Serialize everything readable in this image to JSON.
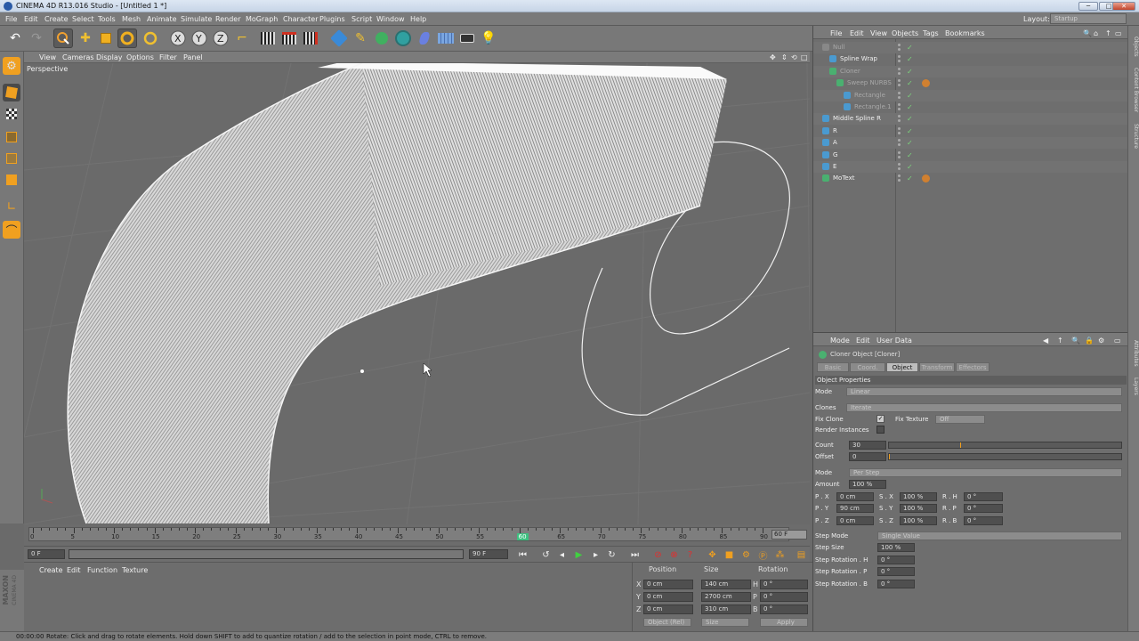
{
  "window": {
    "title": "CINEMA 4D R13.016 Studio - [Untitled 1 *]",
    "min": "─",
    "max": "□",
    "close": "✕"
  },
  "menu": [
    "File",
    "Edit",
    "Create",
    "Select",
    "Tools",
    "Mesh",
    "Animate",
    "Simulate",
    "Render",
    "MoGraph",
    "Character",
    "Plugins",
    "Script",
    "Window",
    "Help"
  ],
  "layout": {
    "label": "Layout:",
    "value": "Startup"
  },
  "viewport": {
    "menu": [
      "View",
      "Cameras",
      "Display",
      "Options",
      "Filter",
      "Panel"
    ],
    "label": "Perspective"
  },
  "timeline": {
    "ticks": [
      "0",
      "5",
      "10",
      "15",
      "20",
      "25",
      "30",
      "35",
      "40",
      "45",
      "50",
      "55",
      "60",
      "65",
      "70",
      "75",
      "80",
      "85",
      "90"
    ],
    "current": "60",
    "end": "60 F"
  },
  "playbar": {
    "start": "0 F",
    "min": "0 F",
    "max": "90 F"
  },
  "material": {
    "menu": [
      "Create",
      "Edit",
      "Function",
      "Texture"
    ]
  },
  "coords": {
    "headers": [
      "Position",
      "Size",
      "Rotation"
    ],
    "rows": [
      {
        "axis": "X",
        "pos": "0 cm",
        "size": "140 cm",
        "rlabel": "H",
        "rot": "0 °"
      },
      {
        "axis": "Y",
        "pos": "0 cm",
        "size": "2700 cm",
        "rlabel": "P",
        "rot": "0 °"
      },
      {
        "axis": "Z",
        "pos": "0 cm",
        "size": "310 cm",
        "rlabel": "B",
        "rot": "0 °"
      }
    ],
    "mode": "Object (Rel)",
    "sizemode": "Size",
    "apply": "Apply"
  },
  "status": {
    "time": "00:00:00",
    "text": "Rotate: Click and drag to rotate elements. Hold down SHIFT to add to quantize rotation / add to the selection in point mode, CTRL to remove."
  },
  "objects": {
    "menu": [
      "File",
      "Edit",
      "View",
      "Objects",
      "Tags",
      "Bookmarks"
    ],
    "items": [
      {
        "name": "Null",
        "indent": 0,
        "dim": true
      },
      {
        "name": "Spline Wrap",
        "indent": 1,
        "dim": false
      },
      {
        "name": "Cloner",
        "indent": 1,
        "dim": true
      },
      {
        "name": "Sweep NURBS",
        "indent": 2,
        "dim": true
      },
      {
        "name": "Rectangle",
        "indent": 3,
        "dim": true
      },
      {
        "name": "Rectangle.1",
        "indent": 3,
        "dim": true
      },
      {
        "name": "Middle Spline R",
        "indent": 0,
        "dim": false
      },
      {
        "name": "R",
        "indent": 0,
        "dim": false
      },
      {
        "name": "A",
        "indent": 0,
        "dim": false
      },
      {
        "name": "G",
        "indent": 0,
        "dim": false
      },
      {
        "name": "E",
        "indent": 0,
        "dim": false
      },
      {
        "name": "MoText",
        "indent": 0,
        "dim": false
      }
    ]
  },
  "attributes": {
    "menu": [
      "Mode",
      "Edit",
      "User Data"
    ],
    "title": "Cloner Object [Cloner]",
    "tabs": [
      "Basic",
      "Coord.",
      "Object",
      "Transform",
      "Effectors"
    ],
    "active_tab": "Object",
    "section": "Object Properties",
    "mode_label": "Mode",
    "mode_value": "Linear",
    "clones_label": "Clones",
    "clones_value": "Iterate",
    "fixclone_label": "Fix Clone",
    "fixtexture_label": "Fix Texture",
    "fixtexture_value": "Off",
    "render_label": "Render Instances",
    "count_label": "Count",
    "count_value": "30",
    "offset_label": "Offset",
    "offset_value": "0",
    "mode2_label": "Mode",
    "mode2_value": "Per Step",
    "amount_label": "Amount",
    "amount_value": "100 %",
    "prs": [
      {
        "p": "P . X",
        "pv": "0 cm",
        "s": "S . X",
        "sv": "100 %",
        "r": "R . H",
        "rv": "0 °"
      },
      {
        "p": "P . Y",
        "pv": "90 cm",
        "s": "S . Y",
        "sv": "100 %",
        "r": "R . P",
        "rv": "0 °"
      },
      {
        "p": "P . Z",
        "pv": "0 cm",
        "s": "S . Z",
        "sv": "100 %",
        "r": "R . B",
        "rv": "0 °"
      }
    ],
    "stepmode_label": "Step Mode",
    "stepmode_value": "Single Value",
    "stepsize_label": "Step Size",
    "stepsize_value": "100 %",
    "steprot": [
      {
        "label": "Step Rotation . H",
        "value": "0 °"
      },
      {
        "label": "Step Rotation . P",
        "value": "0 °"
      },
      {
        "label": "Step Rotation . B",
        "value": "0 °"
      }
    ]
  },
  "sidetabs": [
    "Objects",
    "Content Browser",
    "Structure",
    "Attributes",
    "Layers"
  ]
}
